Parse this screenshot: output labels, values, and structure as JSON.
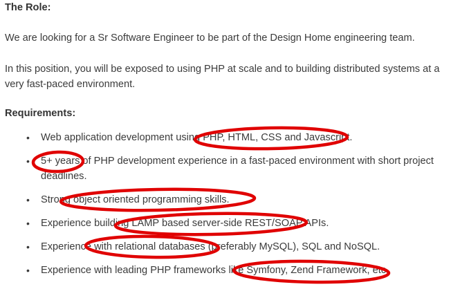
{
  "role_heading": "The Role:",
  "intro": "We are looking for a Sr Software Engineer to be part of the Design Home engineering team.",
  "position_lines": [
    "In this position, you will be exposed to using PHP at scale and to building distributed systems at a",
    "very fast-paced environment."
  ],
  "requirements_heading": "Requirements:",
  "bullet_glyph": "•",
  "requirements": [
    {
      "lines": [
        "Web application development using PHP, HTML, CSS and Javascript."
      ]
    },
    {
      "lines": [
        "5+ years of PHP development experience in a fast-paced environment with short project",
        "deadlines."
      ]
    },
    {
      "lines": [
        "Strong object oriented programming skills."
      ]
    },
    {
      "lines": [
        "Experience building LAMP based server-side REST/SOAP APIs."
      ]
    },
    {
      "lines": [
        "Experience with relational databases (preferably MySQL), SQL and NoSQL."
      ]
    },
    {
      "lines": [
        "Experience with leading PHP frameworks like Symfony, Zend Framework, etc."
      ]
    }
  ],
  "annotation_color": "#e00000"
}
